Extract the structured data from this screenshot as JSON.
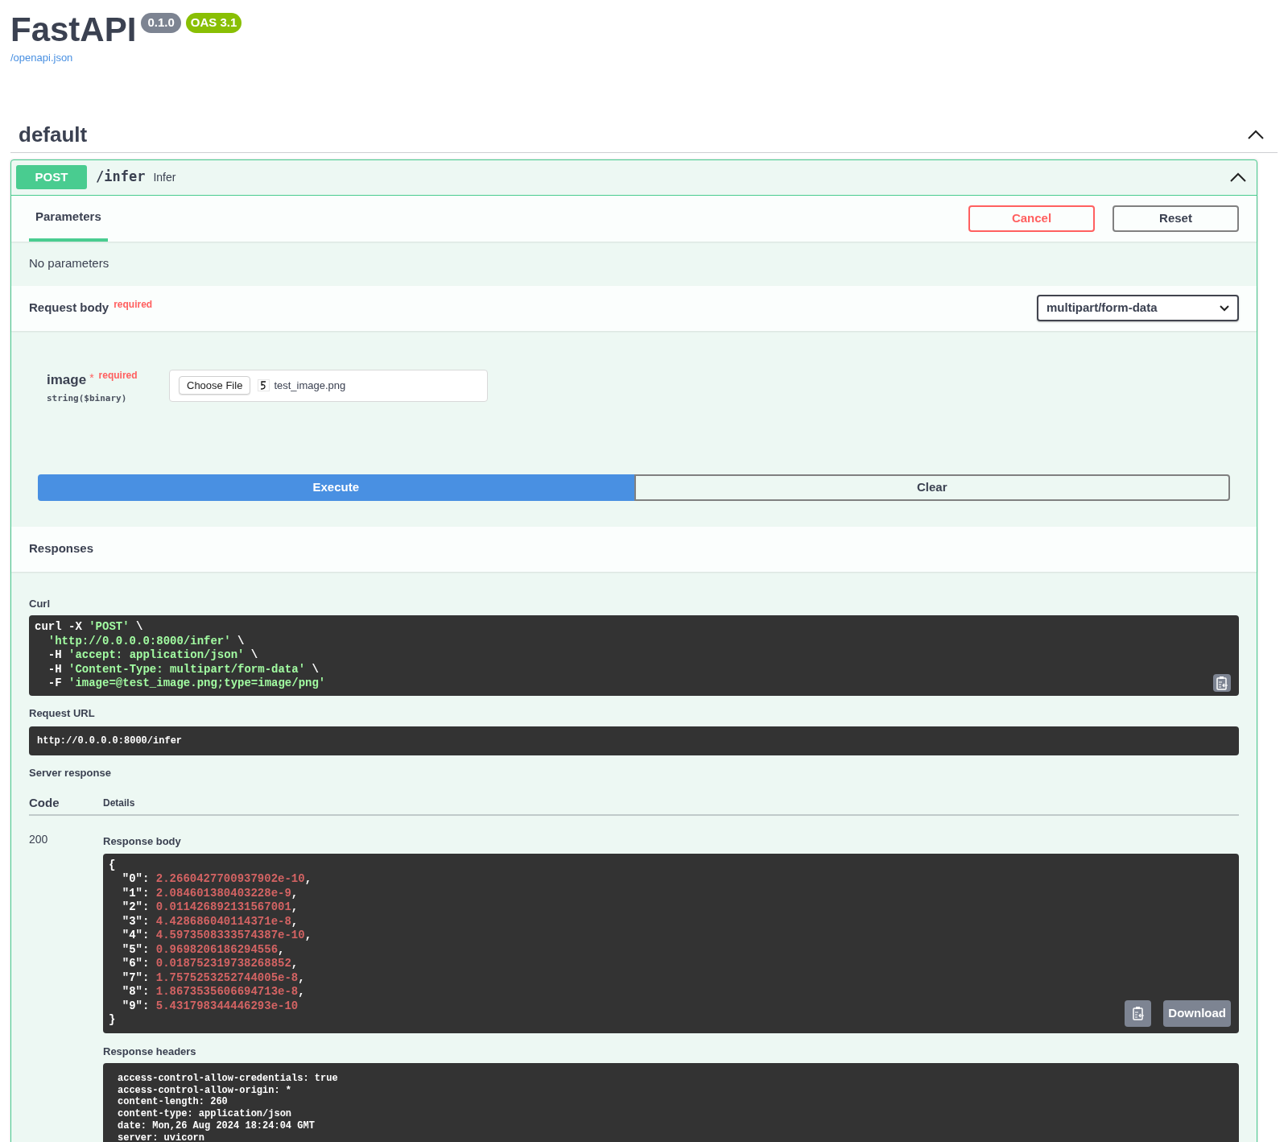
{
  "header": {
    "title": "FastAPI",
    "version": "0.1.0",
    "oas": "OAS 3.1",
    "link": "/openapi.json"
  },
  "section": {
    "title": "default",
    "expanded": true
  },
  "operation": {
    "method": "POST",
    "path": "/infer",
    "summary": "Infer",
    "expanded": true,
    "tabs": [
      {
        "label": "Parameters",
        "selected": true
      }
    ],
    "cancel": "Cancel",
    "reset": "Reset",
    "no_parameters": "No parameters",
    "request_body": {
      "title": "Request body",
      "required": "required",
      "content_type": "multipart/form-data"
    },
    "fields": [
      {
        "name": "image",
        "required_mark": "*",
        "required": "required",
        "type": "string($binary)",
        "choose_label": "Choose File",
        "file_name": "test_image.png"
      }
    ],
    "execute": "Execute",
    "clear": "Clear"
  },
  "responses": {
    "title": "Responses",
    "curl_label": "Curl",
    "curl": [
      [
        {
          "text": "curl -X ",
          "kind": "plain"
        },
        {
          "text": "'POST'",
          "kind": "string"
        },
        {
          "text": " \\",
          "kind": "plain"
        }
      ],
      [
        {
          "text": "  'http://0.0.0.0:8000/infer'",
          "kind": "string"
        },
        {
          "text": " \\",
          "kind": "plain"
        }
      ],
      [
        {
          "text": "  -H ",
          "kind": "plain"
        },
        {
          "text": "'accept: application/json'",
          "kind": "string"
        },
        {
          "text": " \\",
          "kind": "plain"
        }
      ],
      [
        {
          "text": "  -H ",
          "kind": "plain"
        },
        {
          "text": "'Content-Type: multipart/form-data'",
          "kind": "string"
        },
        {
          "text": " \\",
          "kind": "plain"
        }
      ],
      [
        {
          "text": "  -F ",
          "kind": "plain"
        },
        {
          "text": "'image=@test_image.png;type=image/png'",
          "kind": "string"
        }
      ]
    ],
    "request_url_label": "Request URL",
    "request_url": "http://0.0.0.0:8000/infer",
    "server_response_label": "Server response",
    "code_header": "Code",
    "details_header": "Details",
    "rows": [
      {
        "code": "200",
        "body_label": "Response body",
        "body": [
          [
            {
              "text": "{",
              "kind": "plain"
            }
          ],
          [
            {
              "text": "  \"0\": ",
              "kind": "plain"
            },
            {
              "text": "2.2660427700937902e-10",
              "kind": "number"
            },
            {
              "text": ",",
              "kind": "plain"
            }
          ],
          [
            {
              "text": "  \"1\": ",
              "kind": "plain"
            },
            {
              "text": "2.084601380403228e-9",
              "kind": "number"
            },
            {
              "text": ",",
              "kind": "plain"
            }
          ],
          [
            {
              "text": "  \"2\": ",
              "kind": "plain"
            },
            {
              "text": "0.011426892131567001",
              "kind": "number"
            },
            {
              "text": ",",
              "kind": "plain"
            }
          ],
          [
            {
              "text": "  \"3\": ",
              "kind": "plain"
            },
            {
              "text": "4.428686040114371e-8",
              "kind": "number"
            },
            {
              "text": ",",
              "kind": "plain"
            }
          ],
          [
            {
              "text": "  \"4\": ",
              "kind": "plain"
            },
            {
              "text": "4.5973508333574387e-10",
              "kind": "number"
            },
            {
              "text": ",",
              "kind": "plain"
            }
          ],
          [
            {
              "text": "  \"5\": ",
              "kind": "plain"
            },
            {
              "text": "0.9698206186294556",
              "kind": "number"
            },
            {
              "text": ",",
              "kind": "plain"
            }
          ],
          [
            {
              "text": "  \"6\": ",
              "kind": "plain"
            },
            {
              "text": "0.018752319738268852",
              "kind": "number"
            },
            {
              "text": ",",
              "kind": "plain"
            }
          ],
          [
            {
              "text": "  \"7\": ",
              "kind": "plain"
            },
            {
              "text": "1.7575253252744005e-8",
              "kind": "number"
            },
            {
              "text": ",",
              "kind": "plain"
            }
          ],
          [
            {
              "text": "  \"8\": ",
              "kind": "plain"
            },
            {
              "text": "1.8673535606694713e-8",
              "kind": "number"
            },
            {
              "text": ",",
              "kind": "plain"
            }
          ],
          [
            {
              "text": "  \"9\": ",
              "kind": "plain"
            },
            {
              "text": "5.431798344446293e-10",
              "kind": "number"
            }
          ],
          [
            {
              "text": "}",
              "kind": "plain"
            }
          ]
        ],
        "download": "Download",
        "headers_label": "Response headers",
        "headers": [
          "access-control-allow-credentials: true",
          "access-control-allow-origin: *",
          "content-length: 260",
          "content-type: application/json",
          "date: Mon,26 Aug 2024 18:24:04 GMT",
          "server: uvicorn"
        ]
      }
    ]
  }
}
